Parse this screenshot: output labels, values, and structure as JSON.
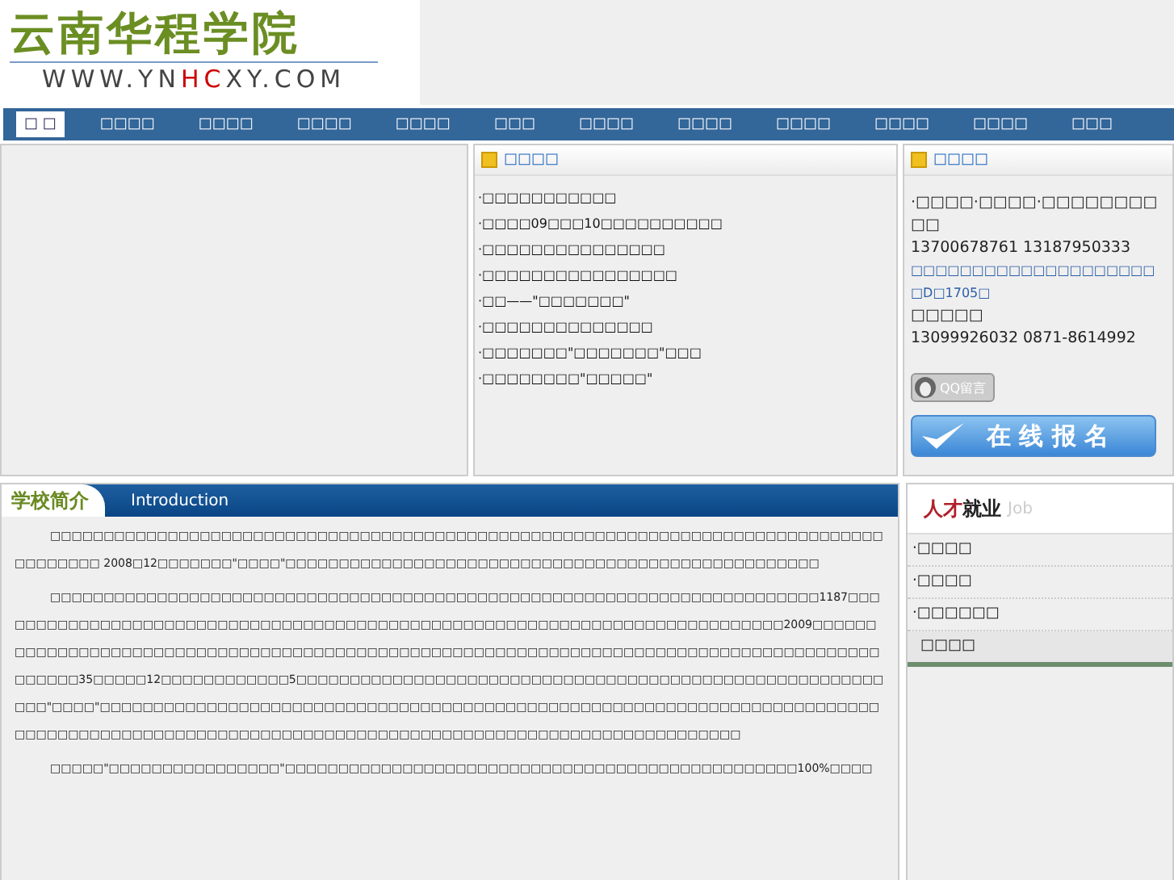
{
  "logo": {
    "name": "云南华程学院",
    "url_parts": [
      "WWW.YN",
      "HC",
      "XY.COM"
    ]
  },
  "nav": [
    {
      "label": "□ □",
      "selected": true
    },
    {
      "label": "□□□□",
      "selected": false
    },
    {
      "label": "□□□□",
      "selected": false
    },
    {
      "label": "□□□□",
      "selected": false
    },
    {
      "label": "□□□□",
      "selected": false
    },
    {
      "label": "□□□",
      "selected": false
    },
    {
      "label": "□□□□",
      "selected": false
    },
    {
      "label": "□□□□",
      "selected": false
    },
    {
      "label": "□□□□",
      "selected": false
    },
    {
      "label": "□□□□",
      "selected": false
    },
    {
      "label": "□□□□",
      "selected": false
    },
    {
      "label": "□□□",
      "selected": false
    }
  ],
  "news": {
    "title": "□□□□",
    "items": [
      "·□□□□□□□□□□□",
      "·□□□□09□□□10□□□□□□□□□□",
      "·□□□□□□□□□□□□□□□",
      "·□□□□□□□□□□□□□□□□",
      "·□□——\"□□□□□□□\"",
      "·□□□□□□□□□□□□□□",
      "·□□□□□□□\"□□□□□□□\"□□□",
      "·□□□□□□□□\"□□□□□\""
    ]
  },
  "contact": {
    "title": "□□□□",
    "lines": [
      {
        "kind": "text",
        "text": "·□□□□·□□□□·□□□□□□□□□□"
      },
      {
        "kind": "text",
        "text": "13700678761  13187950333"
      },
      {
        "kind": "link",
        "text": "□□□□□□□□□□□□□□□□□□□□□D□1705□"
      },
      {
        "kind": "text",
        "text": "□□□□□"
      },
      {
        "kind": "text",
        "text": "13099926032  0871-8614992"
      }
    ],
    "qq_button": "QQ留言",
    "signup_button": "在 线 报 名"
  },
  "intro": {
    "title": "学校简介",
    "subtitle": "Introduction",
    "paragraphs": [
      "□□□□□□□□□□□□□□□□□□□□□□□□□□□□□□□□□□□□□□□□□□□□□□□□□□□□□□□□□□□□□□□□□□□□□□□□□□□□□□□□□□□□□□ 2008□12□□□□□□□\"□□□□\"□□□□□□□□□□□□□□□□□□□□□□□□□□□□□□□□□□□□□□□□□□□□□□□□□□",
      "□□□□□□□□□□□□□□□□□□□□□□□□□□□□□□□□□□□□□□□□□□□□□□□□□□□□□□□□□□□□□□□□□□□□□□□□1187□□□□□□□□□□□□□□□□□□□□□□□□□□□□□□□□□□□□□□□□□□□□□□□□□□□□□□□□□□□□□□□□□□□□□□□□□□□2009□□□□□□□□□□□□□□□□□□□□□□□□□□□□□□□□□□□□□□□□□□□□□□□□□□□□□□□□□□□□□□□□□□□□□□□□□□□□□□□□□□□□□□□□□□□□□35□□□□□12□□□□□□□□□□□□5□□□□□□□□□□□□□□□□□□□□□□□□□□□□□□□□□□□□□□□□□□□□□□□□□□□□□□□□□□\"□□□□\"□□□□□□□□□□□□□□□□□□□□□□□□□□□□□□□□□□□□□□□□□□□□□□□□□□□□□□□□□□□□□□□□□□□□□□□□□□□□□□□□□□□□□□□□□□□□□□□□□□□□□□□□□□□□□□□□□□□□□□□□□□□□□□□□□□□□□□□□□□□□□",
      "□□□□□\"□□□□□□□□□□□□□□□□\"□□□□□□□□□□□□□□□□□□□□□□□□□□□□□□□□□□□□□□□□□□□□□□□□100%□□□□"
    ]
  },
  "jobs": {
    "title_red": "人才",
    "title_dark": "就业",
    "title_en": "Job",
    "items": [
      {
        "label": "·□□□□",
        "selected": false
      },
      {
        "label": "·□□□□",
        "selected": false
      },
      {
        "label": "·□□□□□□",
        "selected": false
      },
      {
        "label": "□□□□",
        "selected": true
      }
    ]
  }
}
